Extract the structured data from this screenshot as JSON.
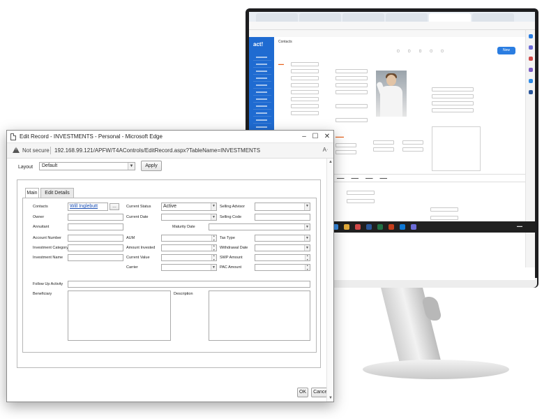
{
  "dialog": {
    "window_title": "Edit Record - INVESTMENTS - Personal - Microsoft Edge",
    "security_label": "Not secure",
    "url": "192.168.99.121/APFW/T4AControls/EditRecord.aspx?TableName=INVESTMENTS",
    "layout_label": "Layout",
    "layout_value": "Default",
    "apply_label": "Apply",
    "tabs": [
      "Main",
      "Edit Details"
    ],
    "fields": {
      "contacts": {
        "label": "Contacts",
        "value": "Will Inglebutt"
      },
      "owner": {
        "label": "Owner",
        "value": ""
      },
      "annuitant": {
        "label": "Annuitant",
        "value": ""
      },
      "account_number": {
        "label": "Account Number",
        "value": ""
      },
      "investment_category": {
        "label": "Investment Category",
        "value": ""
      },
      "investment_name": {
        "label": "Investment Name",
        "value": ""
      },
      "current_status": {
        "label": "Current Status",
        "value": "Active"
      },
      "current_date": {
        "label": "Current Date",
        "value": ""
      },
      "maturity_date": {
        "label": "Maturity Date",
        "value": ""
      },
      "aum": {
        "label": "AUM",
        "value": ""
      },
      "amount_invested": {
        "label": "Amount Invested",
        "value": ""
      },
      "current_value": {
        "label": "Current Value",
        "value": ""
      },
      "carrier": {
        "label": "Carrier",
        "value": ""
      },
      "selling_advisor": {
        "label": "Selling Advisor",
        "value": ""
      },
      "selling_code": {
        "label": "Selling Code",
        "value": ""
      },
      "tax_type": {
        "label": "Tax Type",
        "value": ""
      },
      "withdrawal_date": {
        "label": "Withdrawal Date",
        "value": ""
      },
      "swp_amount": {
        "label": "SWP Amount",
        "value": ""
      },
      "pac_amount": {
        "label": "PAC Amount",
        "value": ""
      },
      "follow_up_activity": {
        "label": "Follow Up Activity",
        "value": ""
      },
      "beneficiary": {
        "label": "Beneficiary",
        "value": ""
      },
      "description": {
        "label": "Description",
        "value": ""
      }
    },
    "ok_label": "OK",
    "cancel_label": "Cancel"
  },
  "background_app": {
    "logo": "act!",
    "page_title": "Contacts",
    "new_button": "New"
  },
  "icons": {
    "doc": "document-icon",
    "warning": "warning-icon",
    "minimize": "minimize-icon",
    "maximize": "maximize-icon",
    "close": "close-icon",
    "read_aloud": "read-aloud-icon"
  },
  "colors": {
    "link": "#1a4fb5",
    "act_sidebar": "#1f6bd1",
    "act_accent": "#e8611a"
  }
}
